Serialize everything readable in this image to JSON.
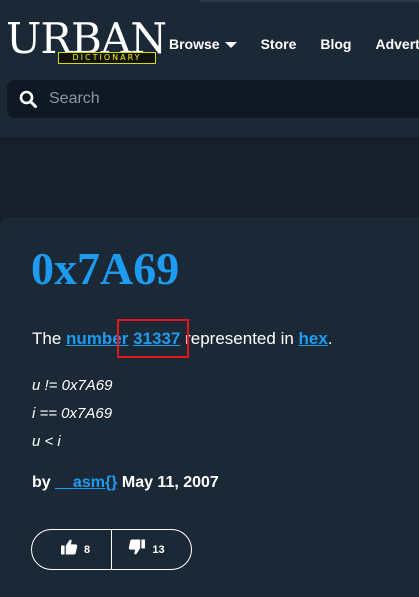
{
  "logo": {
    "main": "URBAN",
    "sub": "DICTIONARY"
  },
  "nav": {
    "items": [
      {
        "label": "Browse",
        "has_dropdown": true
      },
      {
        "label": "Store"
      },
      {
        "label": "Blog"
      },
      {
        "label": "Advertise"
      }
    ]
  },
  "search": {
    "placeholder": "Search",
    "value": ""
  },
  "entry": {
    "word": "0x7A69",
    "meaning": {
      "prefix": "The ",
      "link1": "number",
      "link2": "31337",
      "middle": " represented in ",
      "link3": "hex",
      "suffix": "."
    },
    "example": [
      "u != 0x7A69",
      "i == 0x7A69",
      "u < i"
    ],
    "byline": {
      "prefix": "by ",
      "author": "__asm{}",
      "date": "May 11, 2007"
    },
    "votes": {
      "up": "8",
      "down": "13"
    }
  },
  "colors": {
    "accent": "#1d9bf0",
    "background": "#15202b",
    "card": "#1b2936",
    "highlight": "#e8141c",
    "logo_sub": "#f2f200"
  },
  "icons": {
    "search": "magnifier-icon",
    "dropdown": "chevron-down-icon",
    "upvote": "thumbs-up-icon",
    "downvote": "thumbs-down-icon"
  }
}
